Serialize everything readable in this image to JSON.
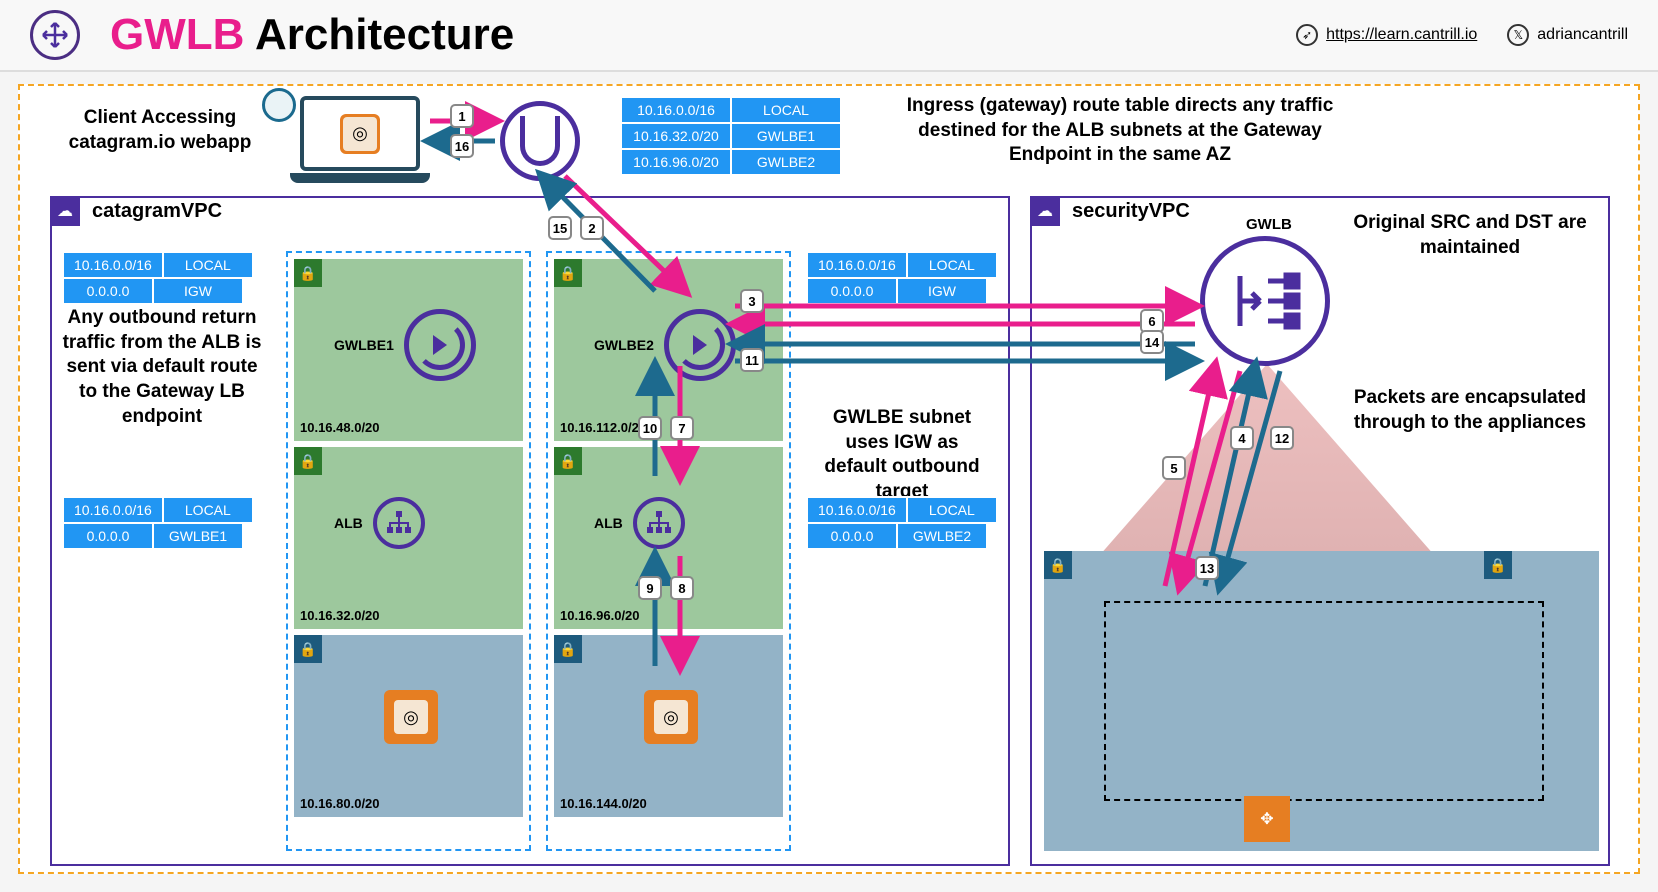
{
  "header": {
    "title_pink": "GWLB",
    "title_rest": " Architecture",
    "link_url": "https://learn.cantrill.io",
    "handle": "adriancantrill"
  },
  "client_label": "Client Accessing catagram.io webapp",
  "ingress_rt": [
    [
      "10.16.0.0/16",
      "LOCAL"
    ],
    [
      "10.16.32.0/20",
      "GWLBE1"
    ],
    [
      "10.16.96.0/20",
      "GWLBE2"
    ]
  ],
  "notes": {
    "ingress": "Ingress (gateway) route table directs any traffic destined for the ALB subnets at the Gateway Endpoint in the same AZ",
    "outbound": "Any outbound return traffic from the ALB is sent via default route to the Gateway LB endpoint",
    "gwlbe_subnet": "GWLBE subnet uses IGW as default outbound target",
    "src_dst": "Original SRC and DST are maintained",
    "encap": "Packets are encapsulated through to the appliances"
  },
  "vpc": {
    "catagram": "catagramVPC",
    "security": "securityVPC"
  },
  "rt_left1": [
    [
      "10.16.0.0/16",
      "LOCAL"
    ],
    [
      "0.0.0.0",
      "IGW"
    ]
  ],
  "rt_left2": [
    [
      "10.16.0.0/16",
      "LOCAL"
    ],
    [
      "0.0.0.0",
      "GWLBE1"
    ]
  ],
  "rt_right1": [
    [
      "10.16.0.0/16",
      "LOCAL"
    ],
    [
      "0.0.0.0",
      "IGW"
    ]
  ],
  "rt_right2": [
    [
      "10.16.0.0/16",
      "LOCAL"
    ],
    [
      "0.0.0.0",
      "GWLBE2"
    ]
  ],
  "az1": {
    "gwlbe": {
      "label": "GWLBE1",
      "cidr": "10.16.48.0/20"
    },
    "alb": {
      "label": "ALB",
      "cidr": "10.16.32.0/20"
    },
    "app": {
      "cidr": "10.16.80.0/20"
    }
  },
  "az2": {
    "gwlbe": {
      "label": "GWLBE2",
      "cidr": "10.16.112.0/20"
    },
    "alb": {
      "label": "ALB",
      "cidr": "10.16.96.0/20"
    },
    "app": {
      "cidr": "10.16.144.0/20"
    }
  },
  "gwlb_label": "GWLB",
  "steps": {
    "s1": "1",
    "s2": "2",
    "s3": "3",
    "s4": "4",
    "s5": "5",
    "s6": "6",
    "s7": "7",
    "s8": "8",
    "s9": "9",
    "s10": "10",
    "s11": "11",
    "s12": "12",
    "s13": "13",
    "s14": "14",
    "s15": "15",
    "s16": "16"
  }
}
